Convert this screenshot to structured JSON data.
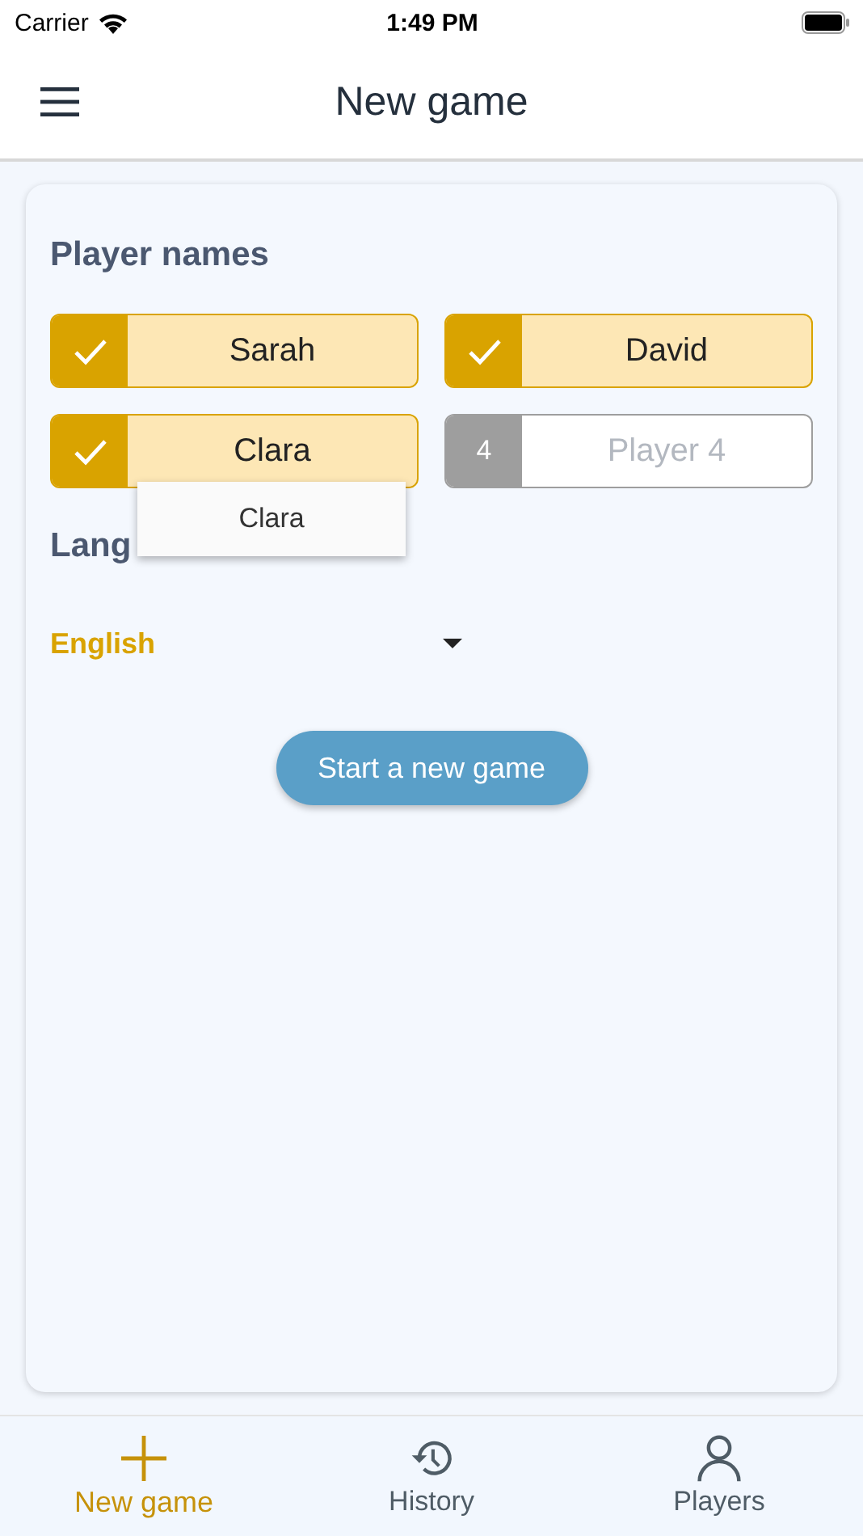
{
  "status_bar": {
    "carrier": "Carrier",
    "time": "1:49 PM"
  },
  "app_bar": {
    "title": "New game"
  },
  "player_section": {
    "heading": "Player names",
    "players": [
      {
        "value": "Sarah",
        "checked": true
      },
      {
        "value": "David",
        "checked": true
      },
      {
        "value": "Clara",
        "checked": true
      },
      {
        "badge": "4",
        "placeholder": "Player 4",
        "checked": false
      }
    ],
    "suggestions": [
      "Clara"
    ]
  },
  "language_section": {
    "heading": "Lang",
    "value": "English"
  },
  "start_button": "Start a new game",
  "bottom_nav": [
    {
      "label": "New game",
      "selected": true
    },
    {
      "label": "History",
      "selected": false
    },
    {
      "label": "Players",
      "selected": false
    }
  ]
}
